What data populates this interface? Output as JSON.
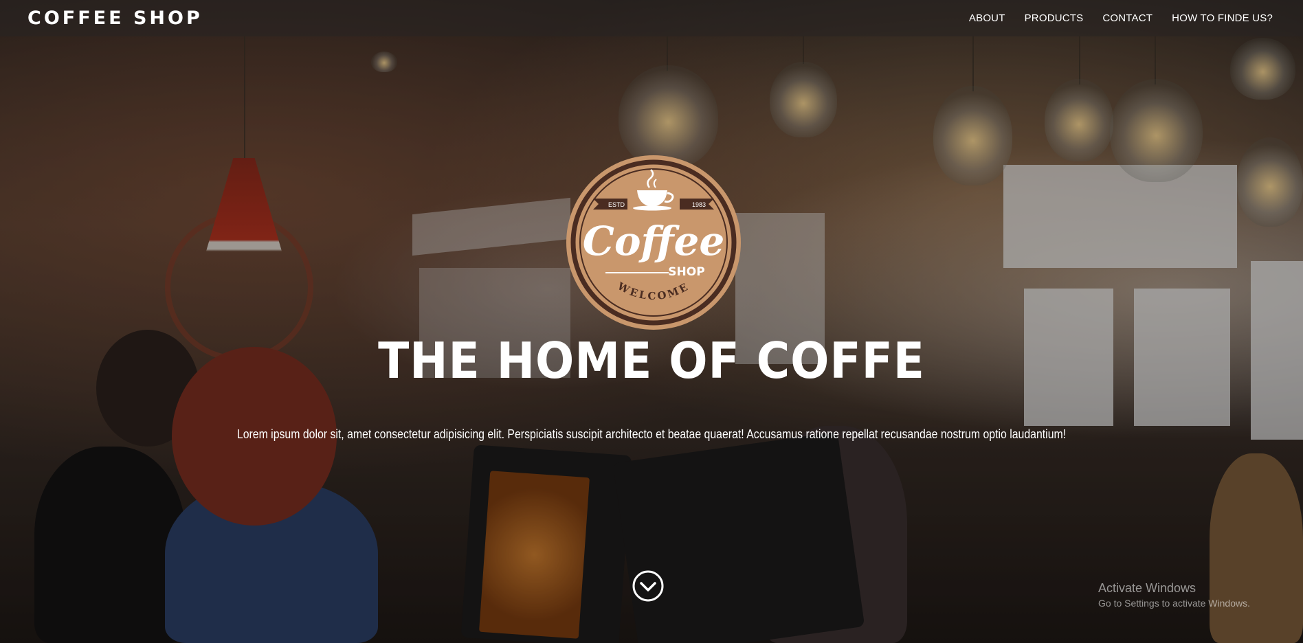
{
  "navbar": {
    "brand": "COFFEE SHOP",
    "links": [
      "ABOUT",
      "PRODUCTS",
      "CONTACT",
      "HOW TO FINDE US?"
    ]
  },
  "logo": {
    "estd": "ESTD",
    "year": "1983",
    "word_main": "Coffee",
    "word_sub": "SHOP",
    "welcome": "WELCOME",
    "colors": {
      "ring": "#4a2c21",
      "fill": "#c9976c",
      "text": "#ffffff"
    }
  },
  "hero": {
    "title": "THE HOME OF COFFE",
    "subtitle": "Lorem ipsum dolor sit, amet consectetur adipisicing elit. Perspiciatis suscipit architecto et beatae quaerat! Accusamus ratione repellat recusandae nostrum optio laudantium!",
    "scroll_icon": "chevron-down-circle-icon"
  },
  "watermark": {
    "title": "Activate Windows",
    "subtitle": "Go to Settings to activate Windows."
  }
}
